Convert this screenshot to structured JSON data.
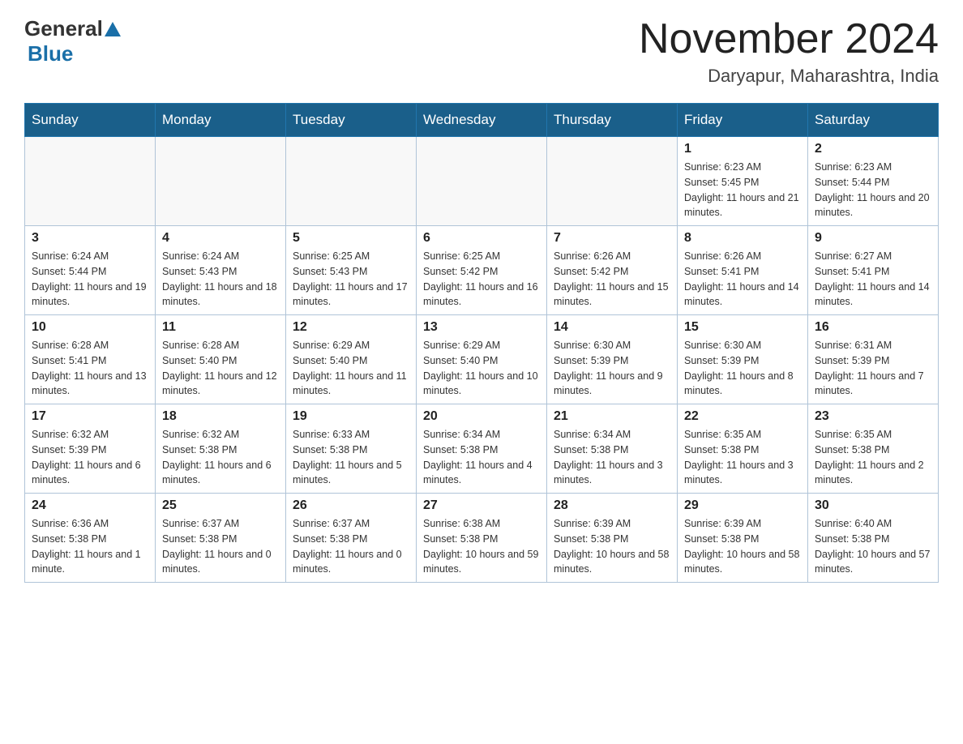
{
  "header": {
    "logo_general": "General",
    "logo_blue": "Blue",
    "month_title": "November 2024",
    "location": "Daryapur, Maharashtra, India"
  },
  "days_of_week": [
    "Sunday",
    "Monday",
    "Tuesday",
    "Wednesday",
    "Thursday",
    "Friday",
    "Saturday"
  ],
  "weeks": [
    [
      {
        "day": "",
        "info": ""
      },
      {
        "day": "",
        "info": ""
      },
      {
        "day": "",
        "info": ""
      },
      {
        "day": "",
        "info": ""
      },
      {
        "day": "",
        "info": ""
      },
      {
        "day": "1",
        "info": "Sunrise: 6:23 AM\nSunset: 5:45 PM\nDaylight: 11 hours and 21 minutes."
      },
      {
        "day": "2",
        "info": "Sunrise: 6:23 AM\nSunset: 5:44 PM\nDaylight: 11 hours and 20 minutes."
      }
    ],
    [
      {
        "day": "3",
        "info": "Sunrise: 6:24 AM\nSunset: 5:44 PM\nDaylight: 11 hours and 19 minutes."
      },
      {
        "day": "4",
        "info": "Sunrise: 6:24 AM\nSunset: 5:43 PM\nDaylight: 11 hours and 18 minutes."
      },
      {
        "day": "5",
        "info": "Sunrise: 6:25 AM\nSunset: 5:43 PM\nDaylight: 11 hours and 17 minutes."
      },
      {
        "day": "6",
        "info": "Sunrise: 6:25 AM\nSunset: 5:42 PM\nDaylight: 11 hours and 16 minutes."
      },
      {
        "day": "7",
        "info": "Sunrise: 6:26 AM\nSunset: 5:42 PM\nDaylight: 11 hours and 15 minutes."
      },
      {
        "day": "8",
        "info": "Sunrise: 6:26 AM\nSunset: 5:41 PM\nDaylight: 11 hours and 14 minutes."
      },
      {
        "day": "9",
        "info": "Sunrise: 6:27 AM\nSunset: 5:41 PM\nDaylight: 11 hours and 14 minutes."
      }
    ],
    [
      {
        "day": "10",
        "info": "Sunrise: 6:28 AM\nSunset: 5:41 PM\nDaylight: 11 hours and 13 minutes."
      },
      {
        "day": "11",
        "info": "Sunrise: 6:28 AM\nSunset: 5:40 PM\nDaylight: 11 hours and 12 minutes."
      },
      {
        "day": "12",
        "info": "Sunrise: 6:29 AM\nSunset: 5:40 PM\nDaylight: 11 hours and 11 minutes."
      },
      {
        "day": "13",
        "info": "Sunrise: 6:29 AM\nSunset: 5:40 PM\nDaylight: 11 hours and 10 minutes."
      },
      {
        "day": "14",
        "info": "Sunrise: 6:30 AM\nSunset: 5:39 PM\nDaylight: 11 hours and 9 minutes."
      },
      {
        "day": "15",
        "info": "Sunrise: 6:30 AM\nSunset: 5:39 PM\nDaylight: 11 hours and 8 minutes."
      },
      {
        "day": "16",
        "info": "Sunrise: 6:31 AM\nSunset: 5:39 PM\nDaylight: 11 hours and 7 minutes."
      }
    ],
    [
      {
        "day": "17",
        "info": "Sunrise: 6:32 AM\nSunset: 5:39 PM\nDaylight: 11 hours and 6 minutes."
      },
      {
        "day": "18",
        "info": "Sunrise: 6:32 AM\nSunset: 5:38 PM\nDaylight: 11 hours and 6 minutes."
      },
      {
        "day": "19",
        "info": "Sunrise: 6:33 AM\nSunset: 5:38 PM\nDaylight: 11 hours and 5 minutes."
      },
      {
        "day": "20",
        "info": "Sunrise: 6:34 AM\nSunset: 5:38 PM\nDaylight: 11 hours and 4 minutes."
      },
      {
        "day": "21",
        "info": "Sunrise: 6:34 AM\nSunset: 5:38 PM\nDaylight: 11 hours and 3 minutes."
      },
      {
        "day": "22",
        "info": "Sunrise: 6:35 AM\nSunset: 5:38 PM\nDaylight: 11 hours and 3 minutes."
      },
      {
        "day": "23",
        "info": "Sunrise: 6:35 AM\nSunset: 5:38 PM\nDaylight: 11 hours and 2 minutes."
      }
    ],
    [
      {
        "day": "24",
        "info": "Sunrise: 6:36 AM\nSunset: 5:38 PM\nDaylight: 11 hours and 1 minute."
      },
      {
        "day": "25",
        "info": "Sunrise: 6:37 AM\nSunset: 5:38 PM\nDaylight: 11 hours and 0 minutes."
      },
      {
        "day": "26",
        "info": "Sunrise: 6:37 AM\nSunset: 5:38 PM\nDaylight: 11 hours and 0 minutes."
      },
      {
        "day": "27",
        "info": "Sunrise: 6:38 AM\nSunset: 5:38 PM\nDaylight: 10 hours and 59 minutes."
      },
      {
        "day": "28",
        "info": "Sunrise: 6:39 AM\nSunset: 5:38 PM\nDaylight: 10 hours and 58 minutes."
      },
      {
        "day": "29",
        "info": "Sunrise: 6:39 AM\nSunset: 5:38 PM\nDaylight: 10 hours and 58 minutes."
      },
      {
        "day": "30",
        "info": "Sunrise: 6:40 AM\nSunset: 5:38 PM\nDaylight: 10 hours and 57 minutes."
      }
    ]
  ]
}
